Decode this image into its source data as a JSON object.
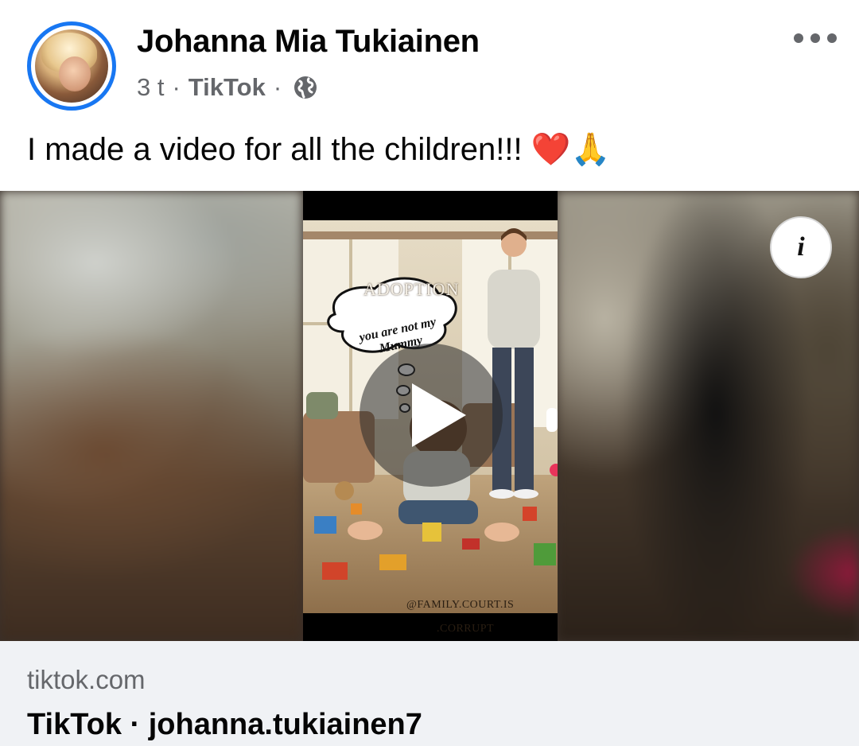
{
  "post": {
    "author": "Johanna Mia Tukiainen",
    "time": "3 t",
    "separator": "·",
    "source": "TikTok",
    "audience_icon": "globe-icon",
    "text": "I made a video for all the children!!! ❤️🙏"
  },
  "media": {
    "overlay_title": "ADOPTION",
    "bubble_text": "you are not my Mummy",
    "credit_line1": "@FAMILY.COURT.IS",
    "credit_line2": ".CORRUPT",
    "play_icon": "play-icon",
    "info_label": "i"
  },
  "link": {
    "domain": "tiktok.com",
    "title": "TikTok · johanna.tukiainen7"
  },
  "colors": {
    "accent_ring": "#1877f2",
    "secondary_text": "#65676b",
    "link_background": "#f0f2f5"
  }
}
